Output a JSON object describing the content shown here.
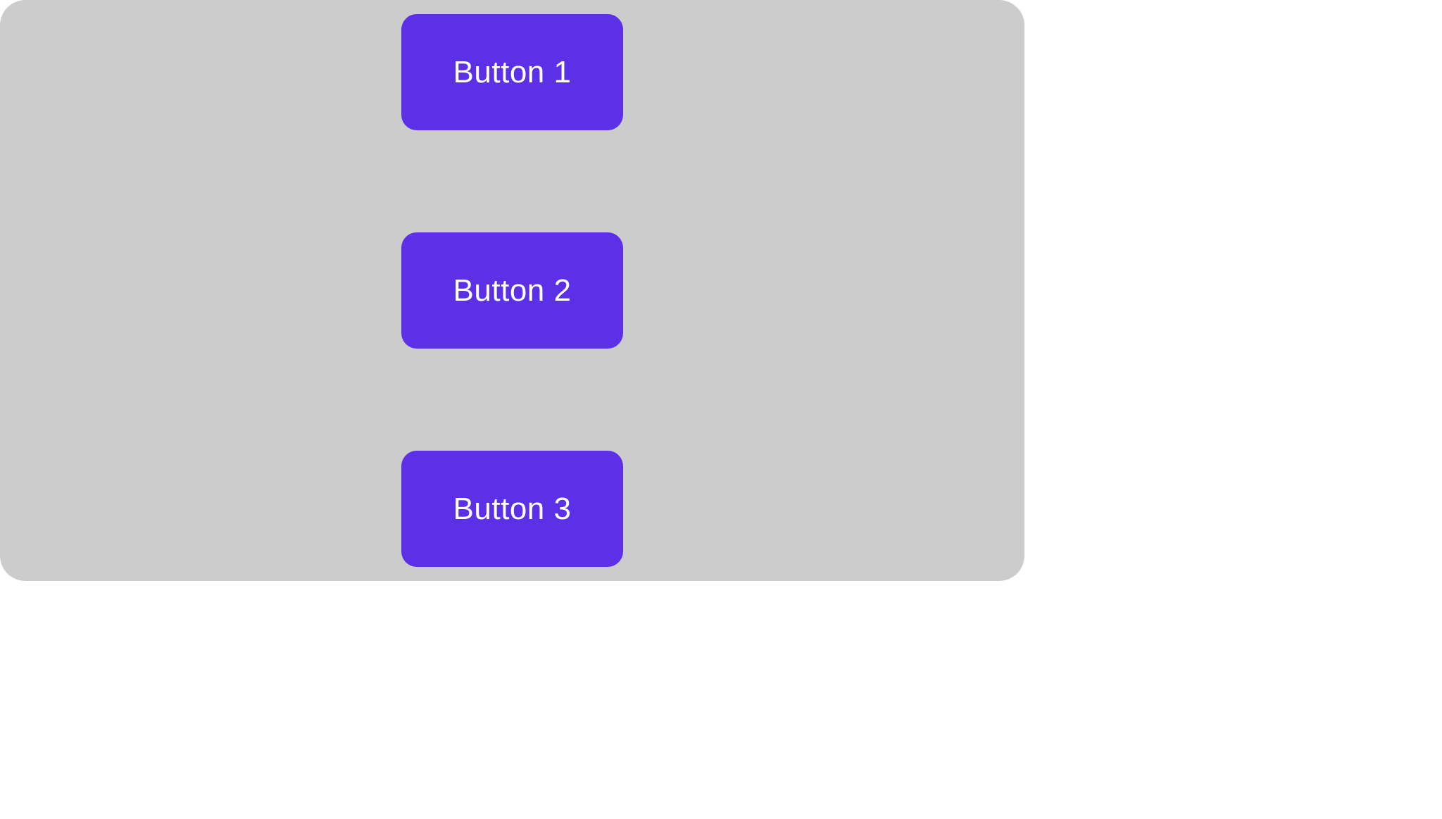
{
  "buttons": {
    "button1": {
      "label": "Button 1"
    },
    "button2": {
      "label": "Button 2"
    },
    "button3": {
      "label": "Button 3"
    }
  }
}
